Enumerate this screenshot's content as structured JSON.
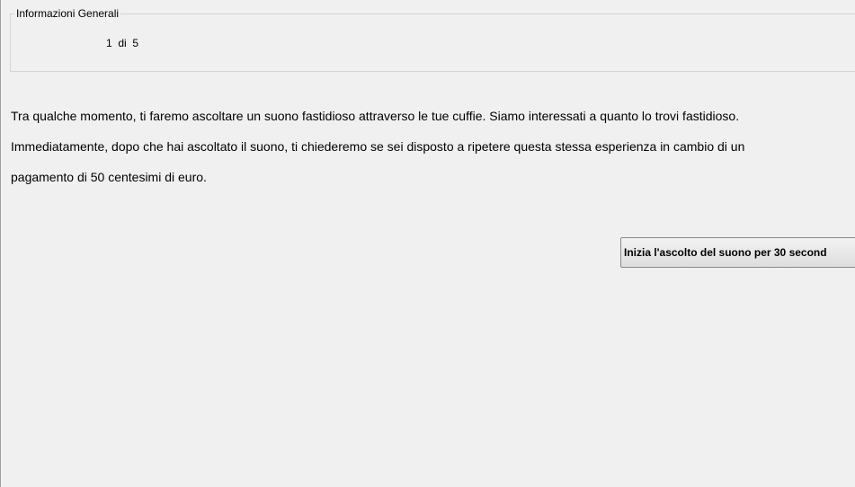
{
  "info_group": {
    "legend": "Informazioni Generali",
    "progress_text": "1  di  5"
  },
  "instructions": {
    "line1": "Tra qualche momento, ti faremo ascoltare un suono fastidioso attraverso le tue cuffie. Siamo interessati a quanto lo trovi fastidioso.",
    "line2": "Immediatamente, dopo che hai ascoltato il suono, ti chiederemo se sei disposto a ripetere questa stessa esperienza in cambio di un",
    "line3": "pagamento di 50 centesimi di euro."
  },
  "start_button": {
    "label": "Inizia l'ascolto del suono per 30 second"
  }
}
